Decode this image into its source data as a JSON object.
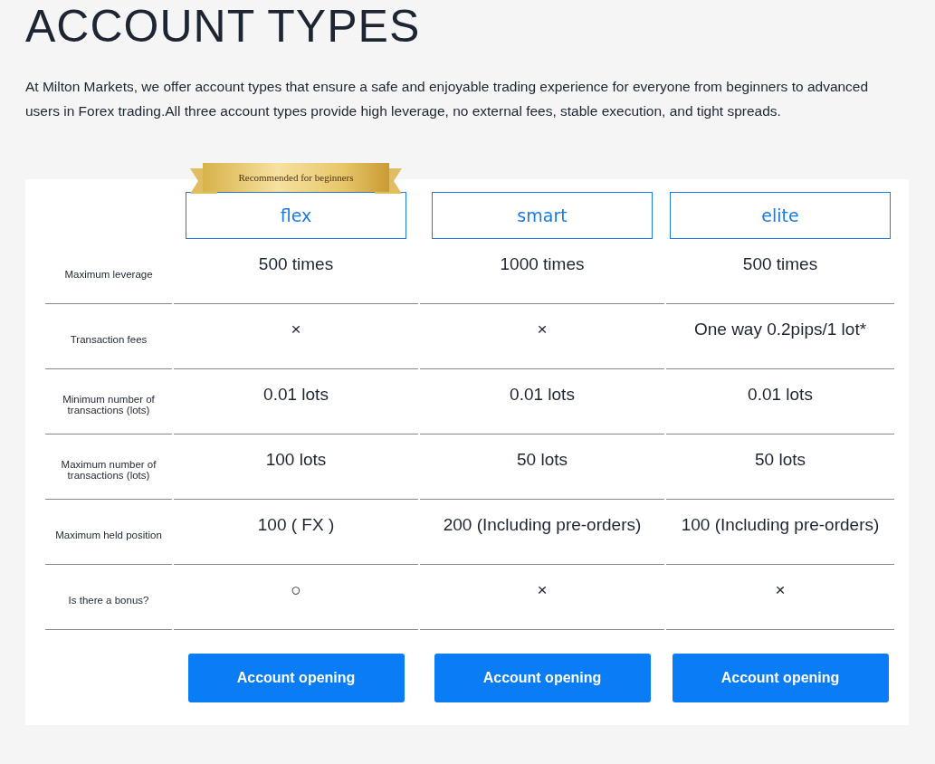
{
  "title": "ACCOUNT TYPES",
  "intro": "At Milton Markets, we offer account types that ensure a safe and enjoyable trading experience for everyone from beginners to advanced users in Forex trading.All three account types provide high leverage, no external fees, stable execution, and tight spreads.",
  "plans": [
    {
      "name": "flex",
      "badge": "Recommended for beginners",
      "button": "Account opening"
    },
    {
      "name": "smart",
      "button": "Account opening"
    },
    {
      "name": "elite",
      "button": "Account opening"
    }
  ],
  "rows": [
    {
      "label": "Maximum leverage",
      "values": [
        "500 times",
        "1000 times",
        "500 times"
      ]
    },
    {
      "label": "Transaction fees",
      "values": [
        "×",
        "×",
        "One way 0.2pips/1 lot*"
      ]
    },
    {
      "label": "Minimum number of transactions (lots)",
      "values": [
        "0.01 lots",
        "0.01 lots",
        "0.01 lots"
      ]
    },
    {
      "label": "Maximum number of transactions (lots)",
      "values": [
        "100 lots",
        "50 lots",
        "50 lots"
      ]
    },
    {
      "label": "Maximum held position",
      "values": [
        "100 ( FX )",
        "200 (Including pre-orders)",
        "100 (Including pre-orders)"
      ]
    },
    {
      "label": "Is there a bonus?",
      "values": [
        "○",
        "×",
        "×"
      ]
    }
  ]
}
